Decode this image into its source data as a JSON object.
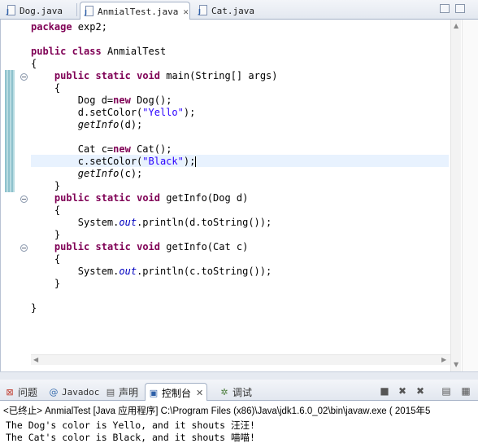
{
  "editor_tabs": [
    {
      "label": "Dog.java",
      "active": false
    },
    {
      "label": "AnmialTest.java",
      "active": true
    },
    {
      "label": "Cat.java",
      "active": false
    }
  ],
  "code_lines": [
    [
      {
        "t": "package",
        "c": "kw"
      },
      {
        "t": " exp2;"
      }
    ],
    [],
    [
      {
        "t": "public",
        "c": "kw"
      },
      {
        "t": " "
      },
      {
        "t": "class",
        "c": "kw"
      },
      {
        "t": " AnmialTest"
      }
    ],
    [
      {
        "t": "{"
      }
    ],
    [
      {
        "t": "    "
      },
      {
        "t": "public",
        "c": "kw"
      },
      {
        "t": " "
      },
      {
        "t": "static",
        "c": "kw"
      },
      {
        "t": " "
      },
      {
        "t": "void",
        "c": "kw"
      },
      {
        "t": " main(String[] args)"
      }
    ],
    [
      {
        "t": "    {"
      }
    ],
    [
      {
        "t": "        Dog d="
      },
      {
        "t": "new",
        "c": "kw"
      },
      {
        "t": " Dog();"
      }
    ],
    [
      {
        "t": "        d.setColor("
      },
      {
        "t": "\"Yello\"",
        "c": "str"
      },
      {
        "t": ");"
      }
    ],
    [
      {
        "t": "        "
      },
      {
        "t": "getInfo",
        "c": "it"
      },
      {
        "t": "(d);"
      }
    ],
    [],
    [
      {
        "t": "        Cat c="
      },
      {
        "t": "new",
        "c": "kw"
      },
      {
        "t": " Cat();"
      }
    ],
    [
      {
        "t": "        c.setColor("
      },
      {
        "t": "\"Black\"",
        "c": "str"
      },
      {
        "t": ");"
      },
      {
        "caret": true
      }
    ],
    [
      {
        "t": "        "
      },
      {
        "t": "getInfo",
        "c": "it"
      },
      {
        "t": "(c);"
      }
    ],
    [
      {
        "t": "    }"
      }
    ],
    [
      {
        "t": "    "
      },
      {
        "t": "public",
        "c": "kw"
      },
      {
        "t": " "
      },
      {
        "t": "static",
        "c": "kw"
      },
      {
        "t": " "
      },
      {
        "t": "void",
        "c": "kw"
      },
      {
        "t": " getInfo(Dog d)"
      }
    ],
    [
      {
        "t": "    {"
      }
    ],
    [
      {
        "t": "        System."
      },
      {
        "t": "out",
        "c": "fld"
      },
      {
        "t": ".println(d.toString());"
      }
    ],
    [
      {
        "t": "    }"
      }
    ],
    [
      {
        "t": "    "
      },
      {
        "t": "public",
        "c": "kw"
      },
      {
        "t": " "
      },
      {
        "t": "static",
        "c": "kw"
      },
      {
        "t": " "
      },
      {
        "t": "void",
        "c": "kw"
      },
      {
        "t": " getInfo(Cat c)"
      }
    ],
    [
      {
        "t": "    {"
      }
    ],
    [
      {
        "t": "        System."
      },
      {
        "t": "out",
        "c": "fld"
      },
      {
        "t": ".println(c.toString());"
      }
    ],
    [
      {
        "t": "    }"
      }
    ],
    [],
    [
      {
        "t": "}"
      }
    ]
  ],
  "view_tabs": [
    {
      "label": "问题",
      "icon": "problems-icon",
      "active": false
    },
    {
      "label": "Javadoc",
      "icon": "javadoc-icon",
      "active": false
    },
    {
      "label": "声明",
      "icon": "declaration-icon",
      "active": false
    },
    {
      "label": "控制台",
      "icon": "console-icon",
      "active": true
    },
    {
      "label": "调试",
      "icon": "debug-icon",
      "active": false
    }
  ],
  "console": {
    "header": "<已终止> AnmialTest [Java 应用程序] C:\\Program Files (x86)\\Java\\jdk1.6.0_02\\bin\\javaw.exe ( 2015年5",
    "lines": [
      "The Dog's color is Yello, and it shouts 汪汪!",
      "The Cat's color is Black, and it shouts 喵喵!"
    ]
  }
}
